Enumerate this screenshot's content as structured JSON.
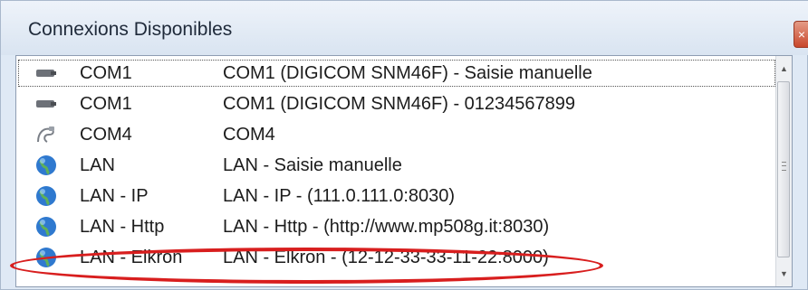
{
  "window": {
    "title": "Connexions Disponibles",
    "close_label": "×"
  },
  "connections": [
    {
      "icon": "serial-port-icon",
      "name": "COM1",
      "description": "COM1 (DIGICOM SNM46F) - Saisie manuelle",
      "selected": true
    },
    {
      "icon": "serial-port-icon",
      "name": "COM1",
      "description": "COM1 (DIGICOM SNM46F) - 01234567899",
      "selected": false
    },
    {
      "icon": "modem-cable-icon",
      "name": "COM4",
      "description": "COM4",
      "selected": false
    },
    {
      "icon": "globe-icon",
      "name": "LAN",
      "description": "LAN - Saisie manuelle",
      "selected": false
    },
    {
      "icon": "globe-icon",
      "name": "LAN - IP",
      "description": "LAN - IP - (111.0.111.0:8030)",
      "selected": false
    },
    {
      "icon": "globe-icon",
      "name": "LAN - Http",
      "description": "LAN - Http - (http://www.mp508g.it:8030)",
      "selected": false
    },
    {
      "icon": "globe-icon",
      "name": "LAN - Elkron",
      "description": "LAN - Elkron - (12-12-33-33-11-22:8000)",
      "selected": false
    }
  ],
  "scrollbar": {
    "up_arrow": "▲",
    "down_arrow": "▼"
  },
  "colors": {
    "highlight": "#d81e1e",
    "selection_border": "#555555"
  }
}
